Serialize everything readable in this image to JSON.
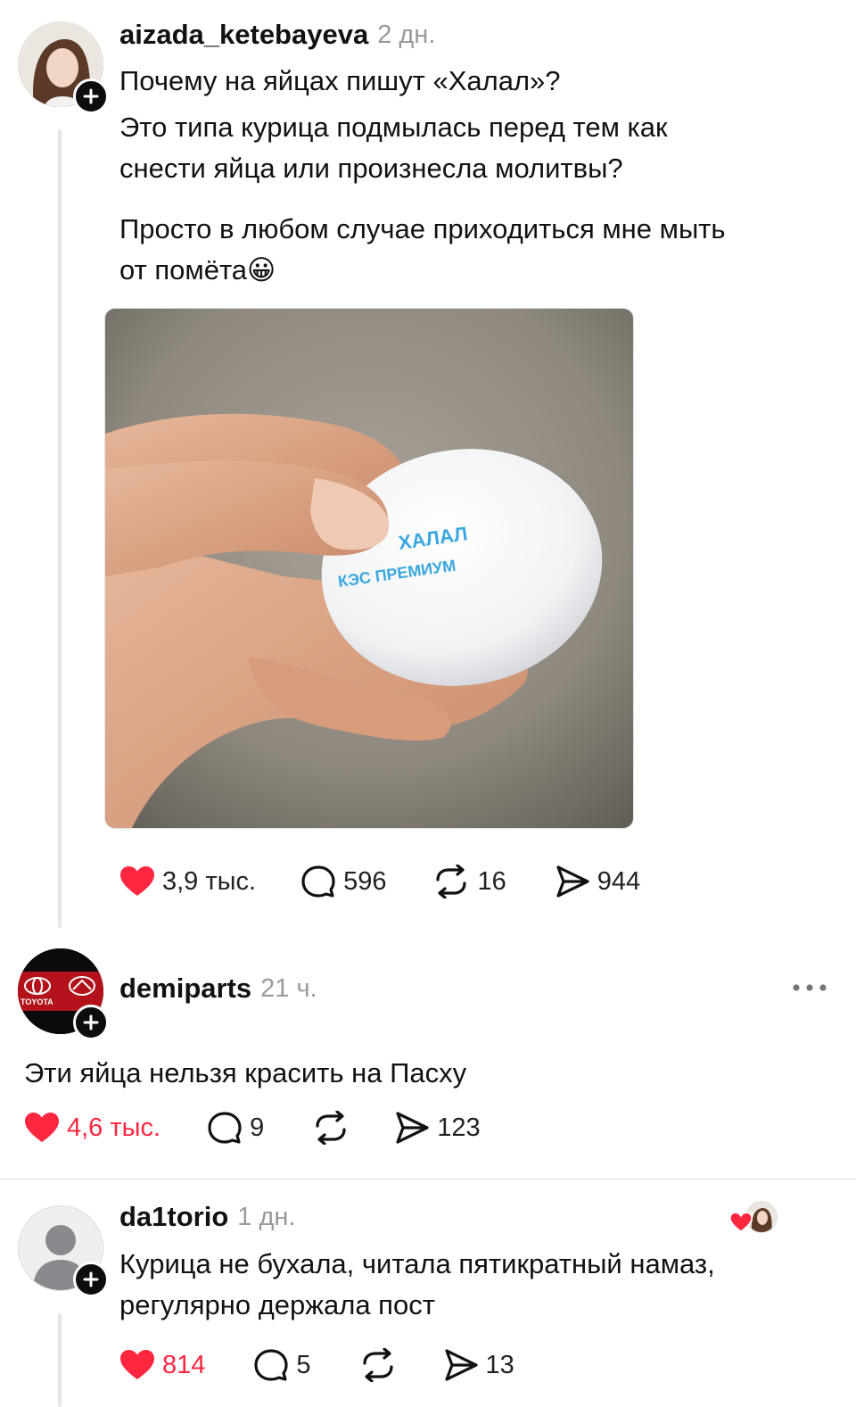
{
  "post": {
    "username": "aizada_ketebayeva",
    "time": "2 дн.",
    "line1": "Почему на яйцах пишут «Халал»?",
    "line2": "Это типа курица подмылась перед тем как",
    "line3": "снести яйца или произнесла молитвы?",
    "line4": "Просто в любом случае приходиться мне мыть",
    "line5": "от помёта",
    "emoji": "😀",
    "egg_print_1": "ХАЛАЛ",
    "egg_print_2": "КЭС ПРЕМИУМ",
    "likes": "3,9 тыс.",
    "comments": "596",
    "reposts": "16",
    "shares": "944"
  },
  "reply1": {
    "username": "demiparts",
    "time": "21 ч.",
    "avatar_text": "TOYOTA",
    "text": "Эти яйца нельзя красить на Пасху",
    "likes": "4,6 тыс.",
    "comments": "9",
    "shares": "123"
  },
  "reply2": {
    "username": "da1torio",
    "time": "1 дн.",
    "line1": "Курица не бухала, читала пятикратный намаз,",
    "line2": "регулярно держала пост",
    "likes": "814",
    "comments": "5",
    "shares": "13"
  },
  "colors": {
    "like": "#ff2740",
    "muted": "#9a9a9a",
    "text": "#111111"
  }
}
